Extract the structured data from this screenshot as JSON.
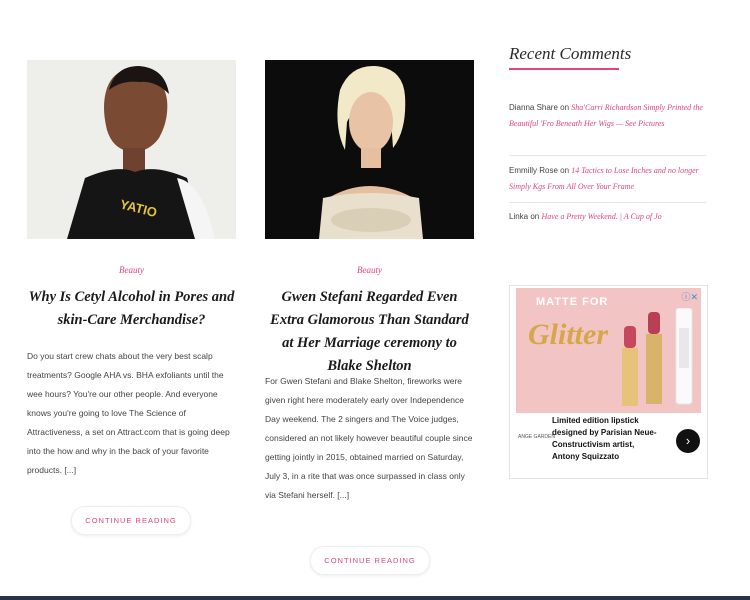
{
  "posts": [
    {
      "category": "Beauty",
      "title": "Why Is Cetyl Alcohol in Pores and skin-Care Merchandise?",
      "excerpt": "Do you start crew chats about the very best scalp treatments? Google AHA vs. BHA exfoliants until the wee hours? You're our other people. And everyone knows you're going to love The Science of Attractiveness, a set on Attract.com that is going deep into the how and why in the back of your favorite products. [...]",
      "button": "CONTINUE READING"
    },
    {
      "category": "Beauty",
      "title": "Gwen Stefani Regarded Even Extra Glamorous Than Standard at Her Marriage ceremony to Blake Shelton",
      "excerpt": "For Gwen Stefani and Blake Shelton, fireworks were given right here moderately early over Independence Day weekend. The 2 singers and The Voice judges, considered an not likely however beautiful couple since getting jointly in 2015, obtained married on Saturday, July 3, in a rite that was once surpassed in class only via Stefani herself. [...]",
      "button": "CONTINUE READING"
    }
  ],
  "sidebar": {
    "recent_title": "Recent Comments",
    "comments": [
      {
        "author": "Dianna Share",
        "on": "on",
        "link": "Sha'Carri Richardson Simply Printed the Beautiful 'Fro Beneath Her Wigs — See Pictures"
      },
      {
        "author": "Emmilly Rose",
        "on": "on",
        "link": "14 Tactics to Lose Inches and no longer Simply Kgs From All Over Your Frame"
      },
      {
        "author": "Linka",
        "on": "on",
        "link": "Have a Pretty Weekend. | A Cup of Jo"
      }
    ]
  },
  "ad": {
    "heading": "MATTE FOR",
    "script": "Glitter",
    "text": "Limited edition lipstick designed by Parisian Neue-Constructivism artist, Antony Squizzato",
    "brand": "ANGE GARDEN",
    "arrow": "›",
    "close": "ⓘ✕"
  },
  "colors": {
    "accent": "#e0457b",
    "footer": "#263342"
  }
}
